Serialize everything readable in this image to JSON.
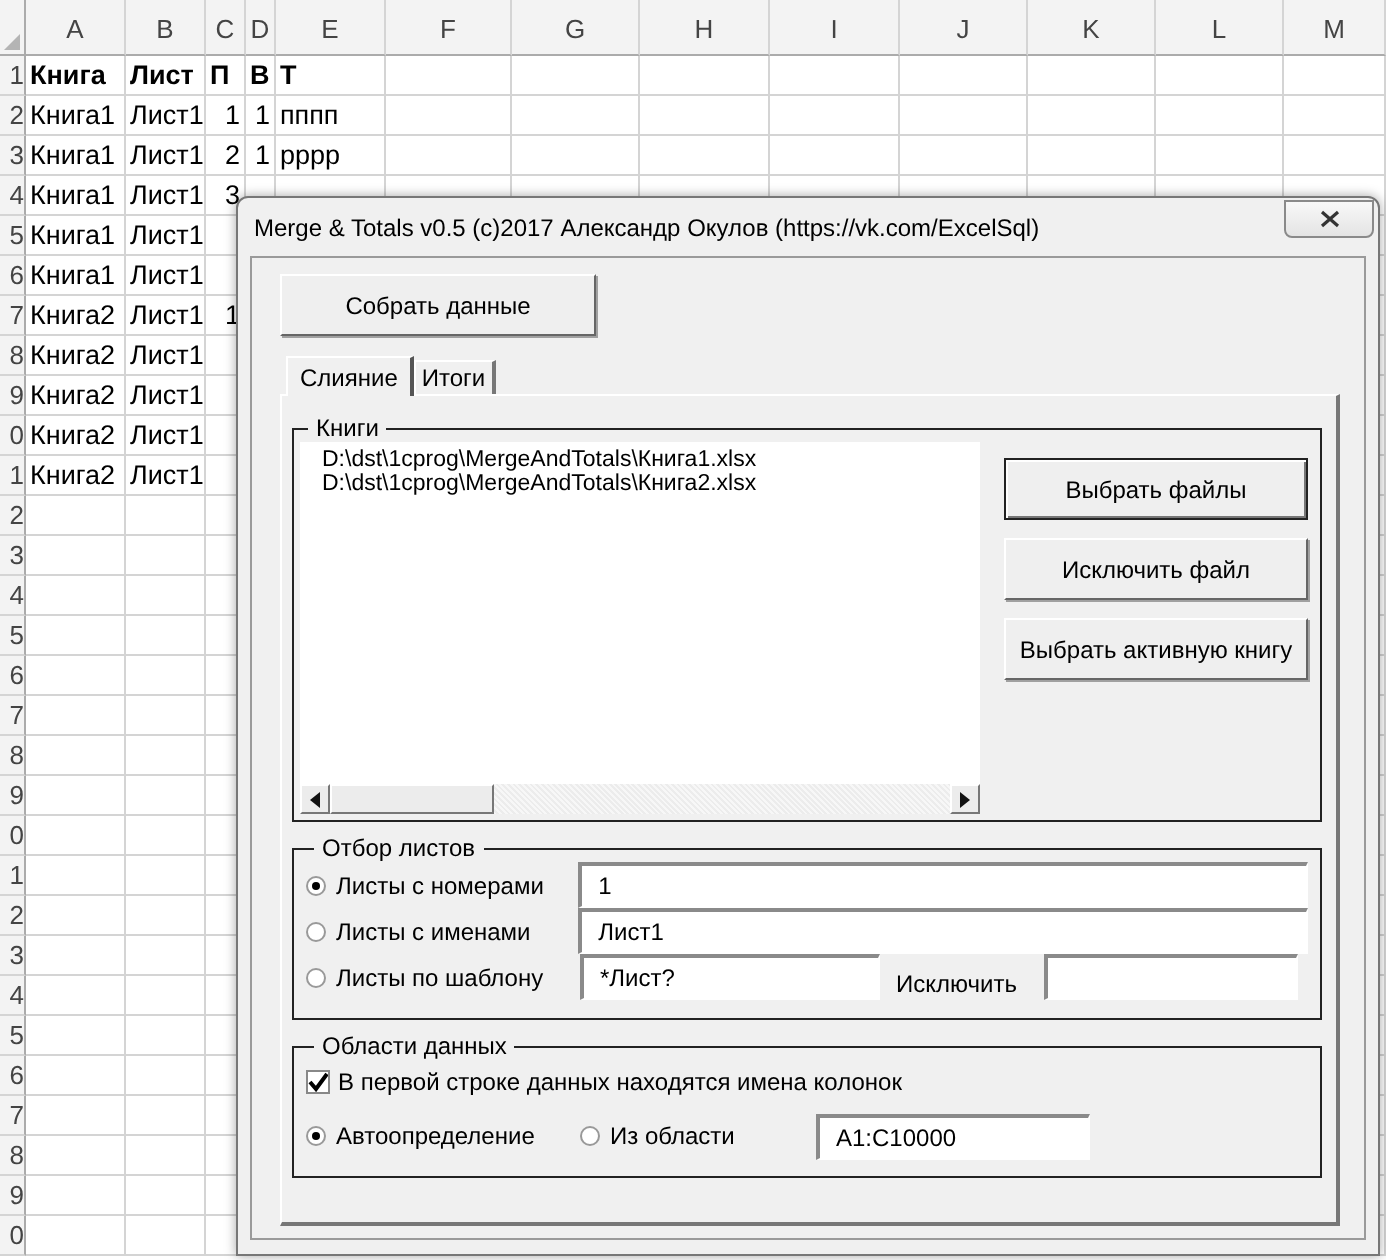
{
  "spreadsheet": {
    "columns": [
      "A",
      "B",
      "C",
      "D",
      "E",
      "F",
      "G",
      "H",
      "I",
      "J",
      "K",
      "L",
      "M"
    ],
    "row_numbers": [
      "1",
      "2",
      "3",
      "4",
      "5",
      "6",
      "7",
      "8",
      "9",
      "0",
      "1",
      "2",
      "3",
      "4",
      "5",
      "6",
      "7",
      "8",
      "9",
      "0",
      "1",
      "2",
      "3",
      "4",
      "5",
      "6",
      "7",
      "8",
      "9",
      "0"
    ],
    "rows": [
      {
        "bold": true,
        "cells": [
          "Книга",
          "Лист",
          "П",
          "В",
          "Т"
        ]
      },
      {
        "bold": false,
        "cells": [
          "Книга1",
          "Лист1",
          "1",
          "1",
          "пппп"
        ]
      },
      {
        "bold": false,
        "cells": [
          "Книга1",
          "Лист1",
          "2",
          "1",
          "рррр"
        ]
      },
      {
        "bold": false,
        "cells": [
          "Книга1",
          "Лист1",
          "3"
        ]
      },
      {
        "bold": false,
        "cells": [
          "Книга1",
          "Лист1"
        ]
      },
      {
        "bold": false,
        "cells": [
          "Книга1",
          "Лист1"
        ]
      },
      {
        "bold": false,
        "cells": [
          "Книга2",
          "Лист1",
          "1"
        ]
      },
      {
        "bold": false,
        "cells": [
          "Книга2",
          "Лист1"
        ]
      },
      {
        "bold": false,
        "cells": [
          "Книга2",
          "Лист1"
        ]
      },
      {
        "bold": false,
        "cells": [
          "Книга2",
          "Лист1"
        ]
      },
      {
        "bold": false,
        "cells": [
          "Книга2",
          "Лист1"
        ]
      }
    ]
  },
  "dialog": {
    "title": "Merge & Totals v0.5 (c)2017 Александр Окулов (https://vk.com/ExcelSql)",
    "collect_button": "Собрать данные",
    "tabs": [
      {
        "label": "Слияние",
        "selected": true
      },
      {
        "label": "Итоги",
        "selected": false
      }
    ],
    "books": {
      "title": "Книги",
      "files": [
        "D:\\dst\\1cprog\\MergeAndTotals\\Книга1.xlsx",
        "D:\\dst\\1cprog\\MergeAndTotals\\Книга2.xlsx"
      ],
      "buttons": [
        {
          "label": "Выбрать файлы",
          "default": true
        },
        {
          "label": "Исключить файл",
          "default": false
        },
        {
          "label": "Выбрать активную книгу",
          "default": false
        }
      ]
    },
    "sheet_filter": {
      "title": "Отбор листов",
      "options": [
        {
          "label": "Листы с номерами",
          "selected": true,
          "value": "1"
        },
        {
          "label": "Листы с именами",
          "selected": false,
          "value": "Лист1"
        },
        {
          "label": "Листы по шаблону",
          "selected": false,
          "value": "*Лист?",
          "exclude_label": "Исключить"
        }
      ]
    },
    "data_areas": {
      "title": "Области данных",
      "header_checkbox": {
        "label": "В первой строке данных находятся имена колонок",
        "checked": true
      },
      "modes": [
        {
          "label": "Автоопределение",
          "selected": true
        },
        {
          "label": "Из области",
          "selected": false,
          "value": "A1:C10000"
        }
      ]
    }
  }
}
